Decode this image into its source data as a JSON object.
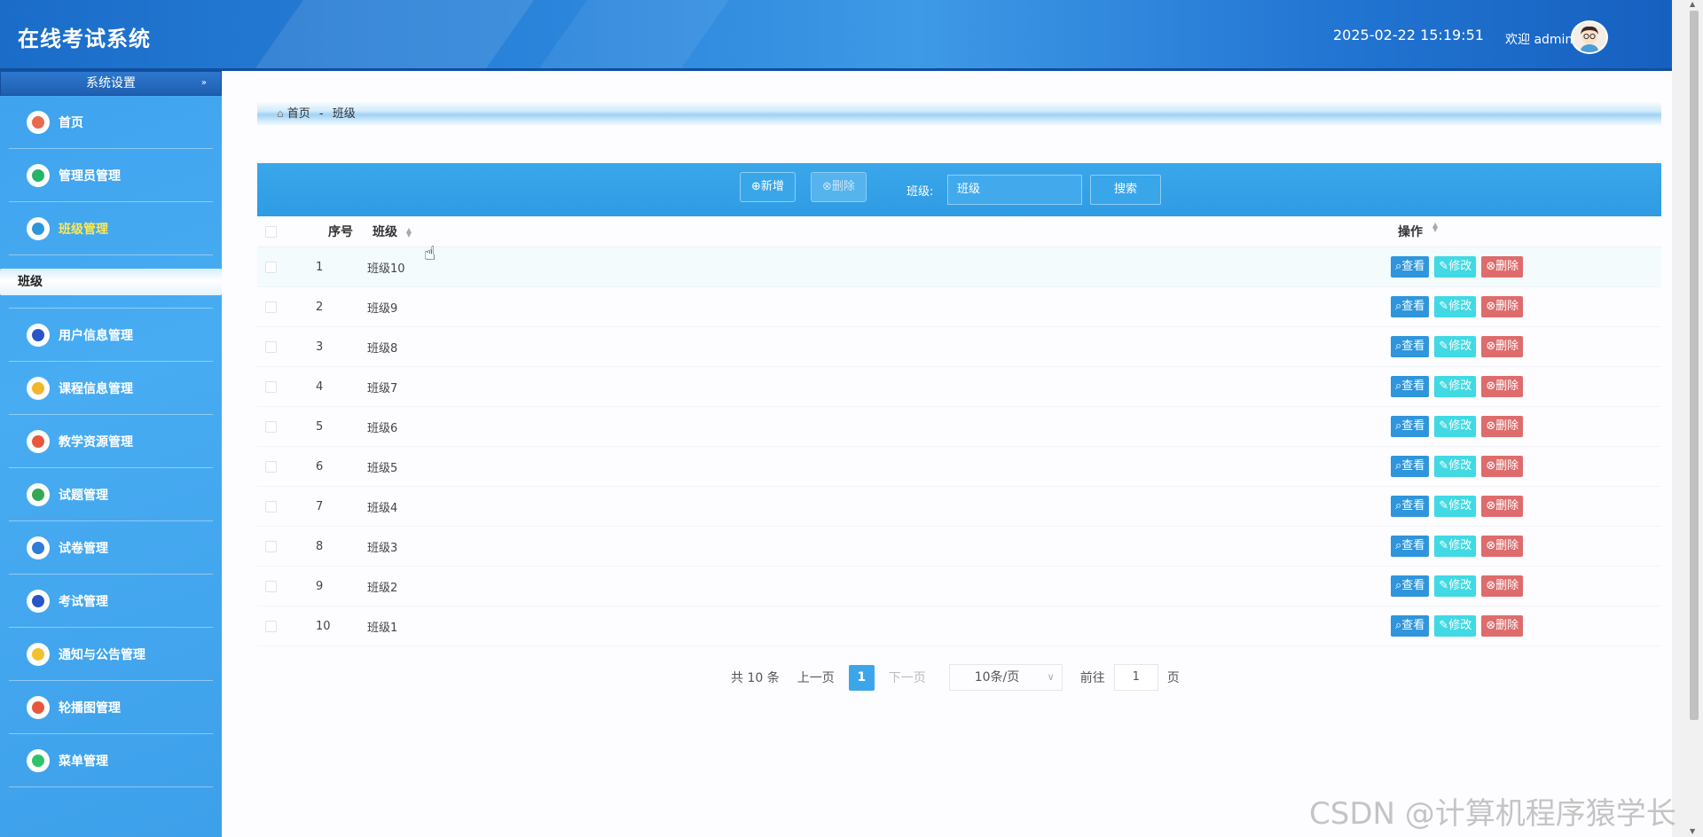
{
  "header": {
    "app_title": "在线考试系统",
    "datetime": "2025-02-22 15:19:51",
    "welcome": "欢迎 admin"
  },
  "sidebar": {
    "section_title": "系统设置",
    "collapse_icon": "double-chevron-down-icon",
    "items": [
      {
        "label": "首页",
        "icon": "home-icon",
        "color": "#e86a4f"
      },
      {
        "label": "管理员管理",
        "icon": "admin-user-icon",
        "color": "#26b36a"
      },
      {
        "label": "班级管理",
        "icon": "compass-icon",
        "color": "#2f95dc",
        "active": true
      },
      {
        "label": "用户信息管理",
        "icon": "user-icon",
        "color": "#2855c9"
      },
      {
        "label": "课程信息管理",
        "icon": "notebook-icon",
        "color": "#f0b62d"
      },
      {
        "label": "教学资源管理",
        "icon": "grid-icon",
        "color": "#e8573d"
      },
      {
        "label": "试题管理",
        "icon": "calendar-icon",
        "color": "#34a853"
      },
      {
        "label": "试卷管理",
        "icon": "list-icon",
        "color": "#2f7dd8"
      },
      {
        "label": "考试管理",
        "icon": "ticket-icon",
        "color": "#2855c9"
      },
      {
        "label": "通知与公告管理",
        "icon": "bell-icon",
        "color": "#f0c230"
      },
      {
        "label": "轮播图管理",
        "icon": "image-icon",
        "color": "#e8573d"
      },
      {
        "label": "菜单管理",
        "icon": "leaf-icon",
        "color": "#2ec46b"
      }
    ],
    "sub_item": "班级"
  },
  "breadcrumb": {
    "home": "首页",
    "separator": "-",
    "current": "班级"
  },
  "toolbar": {
    "add": "新增",
    "delete": "删除",
    "filter_label": "班级:",
    "filter_value": "班级",
    "search": "搜索"
  },
  "table": {
    "headers": {
      "index": "序号",
      "class": "班级",
      "ops": "操作"
    },
    "rows": [
      {
        "index": "1",
        "class": "班级10"
      },
      {
        "index": "2",
        "class": "班级9"
      },
      {
        "index": "3",
        "class": "班级8"
      },
      {
        "index": "4",
        "class": "班级7"
      },
      {
        "index": "5",
        "class": "班级6"
      },
      {
        "index": "6",
        "class": "班级5"
      },
      {
        "index": "7",
        "class": "班级4"
      },
      {
        "index": "8",
        "class": "班级3"
      },
      {
        "index": "9",
        "class": "班级2"
      },
      {
        "index": "10",
        "class": "班级1"
      }
    ],
    "row_actions": {
      "view": "查看",
      "edit": "修改",
      "delete": "删除"
    }
  },
  "pagination": {
    "total": "共 10 条",
    "prev": "上一页",
    "current": "1",
    "next": "下一页",
    "page_size": "10条/页",
    "goto_label": "前往",
    "goto_value": "1",
    "page_suffix": "页"
  },
  "watermark": "CSDN @计算机程序猿学长"
}
